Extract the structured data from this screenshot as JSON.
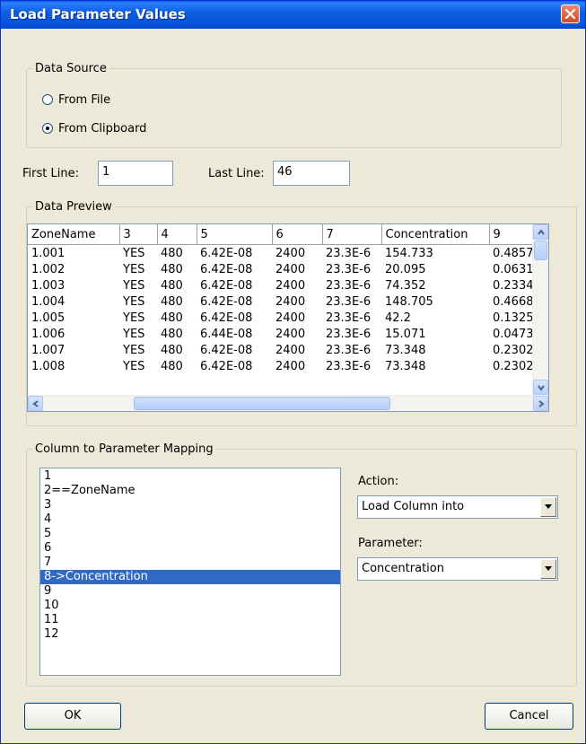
{
  "window": {
    "title": "Load Parameter Values"
  },
  "data_source": {
    "legend": "Data Source",
    "options": [
      {
        "label": "From File",
        "checked": false
      },
      {
        "label": "From Clipboard",
        "checked": true
      }
    ]
  },
  "lines": {
    "first_label": "First Line:",
    "first_value": "1",
    "last_label": "Last Line:",
    "last_value": "46"
  },
  "preview": {
    "legend": "Data Preview",
    "columns": [
      "ZoneName",
      "3",
      "4",
      "5",
      "6",
      "7",
      "Concentration",
      "9"
    ],
    "rows": [
      [
        "1.001",
        "YES",
        "480",
        "6.42E-08",
        "2400",
        "23.3E-6",
        "154.733",
        "0.4857"
      ],
      [
        "1.002",
        "YES",
        "480",
        "6.42E-08",
        "2400",
        "23.3E-6",
        "20.095",
        "0.0631"
      ],
      [
        "1.003",
        "YES",
        "480",
        "6.42E-08",
        "2400",
        "23.3E-6",
        "74.352",
        "0.2334"
      ],
      [
        "1.004",
        "YES",
        "480",
        "6.42E-08",
        "2400",
        "23.3E-6",
        "148.705",
        "0.4668"
      ],
      [
        "1.005",
        "YES",
        "480",
        "6.42E-08",
        "2400",
        "23.3E-6",
        "42.2",
        "0.1325"
      ],
      [
        "1.006",
        "YES",
        "480",
        "6.44E-08",
        "2400",
        "23.3E-6",
        "15.071",
        "0.0473"
      ],
      [
        "1.007",
        "YES",
        "480",
        "6.42E-08",
        "2400",
        "23.3E-6",
        "73.348",
        "0.2302"
      ],
      [
        "1.008",
        "YES",
        "480",
        "6.42E-08",
        "2400",
        "23.3E-6",
        "73.348",
        "0.2302"
      ]
    ]
  },
  "mapping": {
    "legend": "Column to Parameter Mapping",
    "items": [
      "1",
      "2==ZoneName",
      "3",
      "4",
      "5",
      "6",
      "7",
      "8->Concentration",
      "9",
      "10",
      "11",
      "12"
    ],
    "selected_index": 7,
    "action_label": "Action:",
    "action_value": "Load Column into",
    "parameter_label": "Parameter:",
    "parameter_value": "Concentration"
  },
  "buttons": {
    "ok": "OK",
    "cancel": "Cancel"
  },
  "colors": {
    "title_bar": "#0653dc",
    "selection": "#316ac5",
    "dialog_bg": "#ece9d8",
    "close": "#d34b25"
  }
}
